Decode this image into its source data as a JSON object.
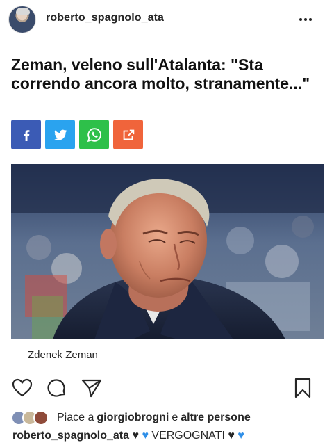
{
  "header": {
    "username": "roberto_spagnolo_ata",
    "more_icon": "more-horizontal-icon"
  },
  "post": {
    "headline": "Zeman, veleno sull'Atalanta: \"Sta correndo ancora molto, stranamente...\"",
    "share_buttons": [
      {
        "icon": "facebook-icon",
        "color": "#3b5bb5"
      },
      {
        "icon": "twitter-icon",
        "color": "#2aa3ef"
      },
      {
        "icon": "whatsapp-icon",
        "color": "#2ec04a"
      },
      {
        "icon": "share-icon",
        "color": "#f0643b"
      }
    ],
    "photo_caption": "Zdenek Zeman"
  },
  "actions": {
    "like_icon": "heart-icon",
    "comment_icon": "comment-icon",
    "send_icon": "send-icon",
    "save_icon": "bookmark-icon"
  },
  "likes": {
    "prefix": "Piace a",
    "user": "giorgiobrogni",
    "connector": "e",
    "others": "altre persone"
  },
  "caption": {
    "username": "roberto_spagnolo_ata",
    "text": "VERGOGNATI"
  }
}
